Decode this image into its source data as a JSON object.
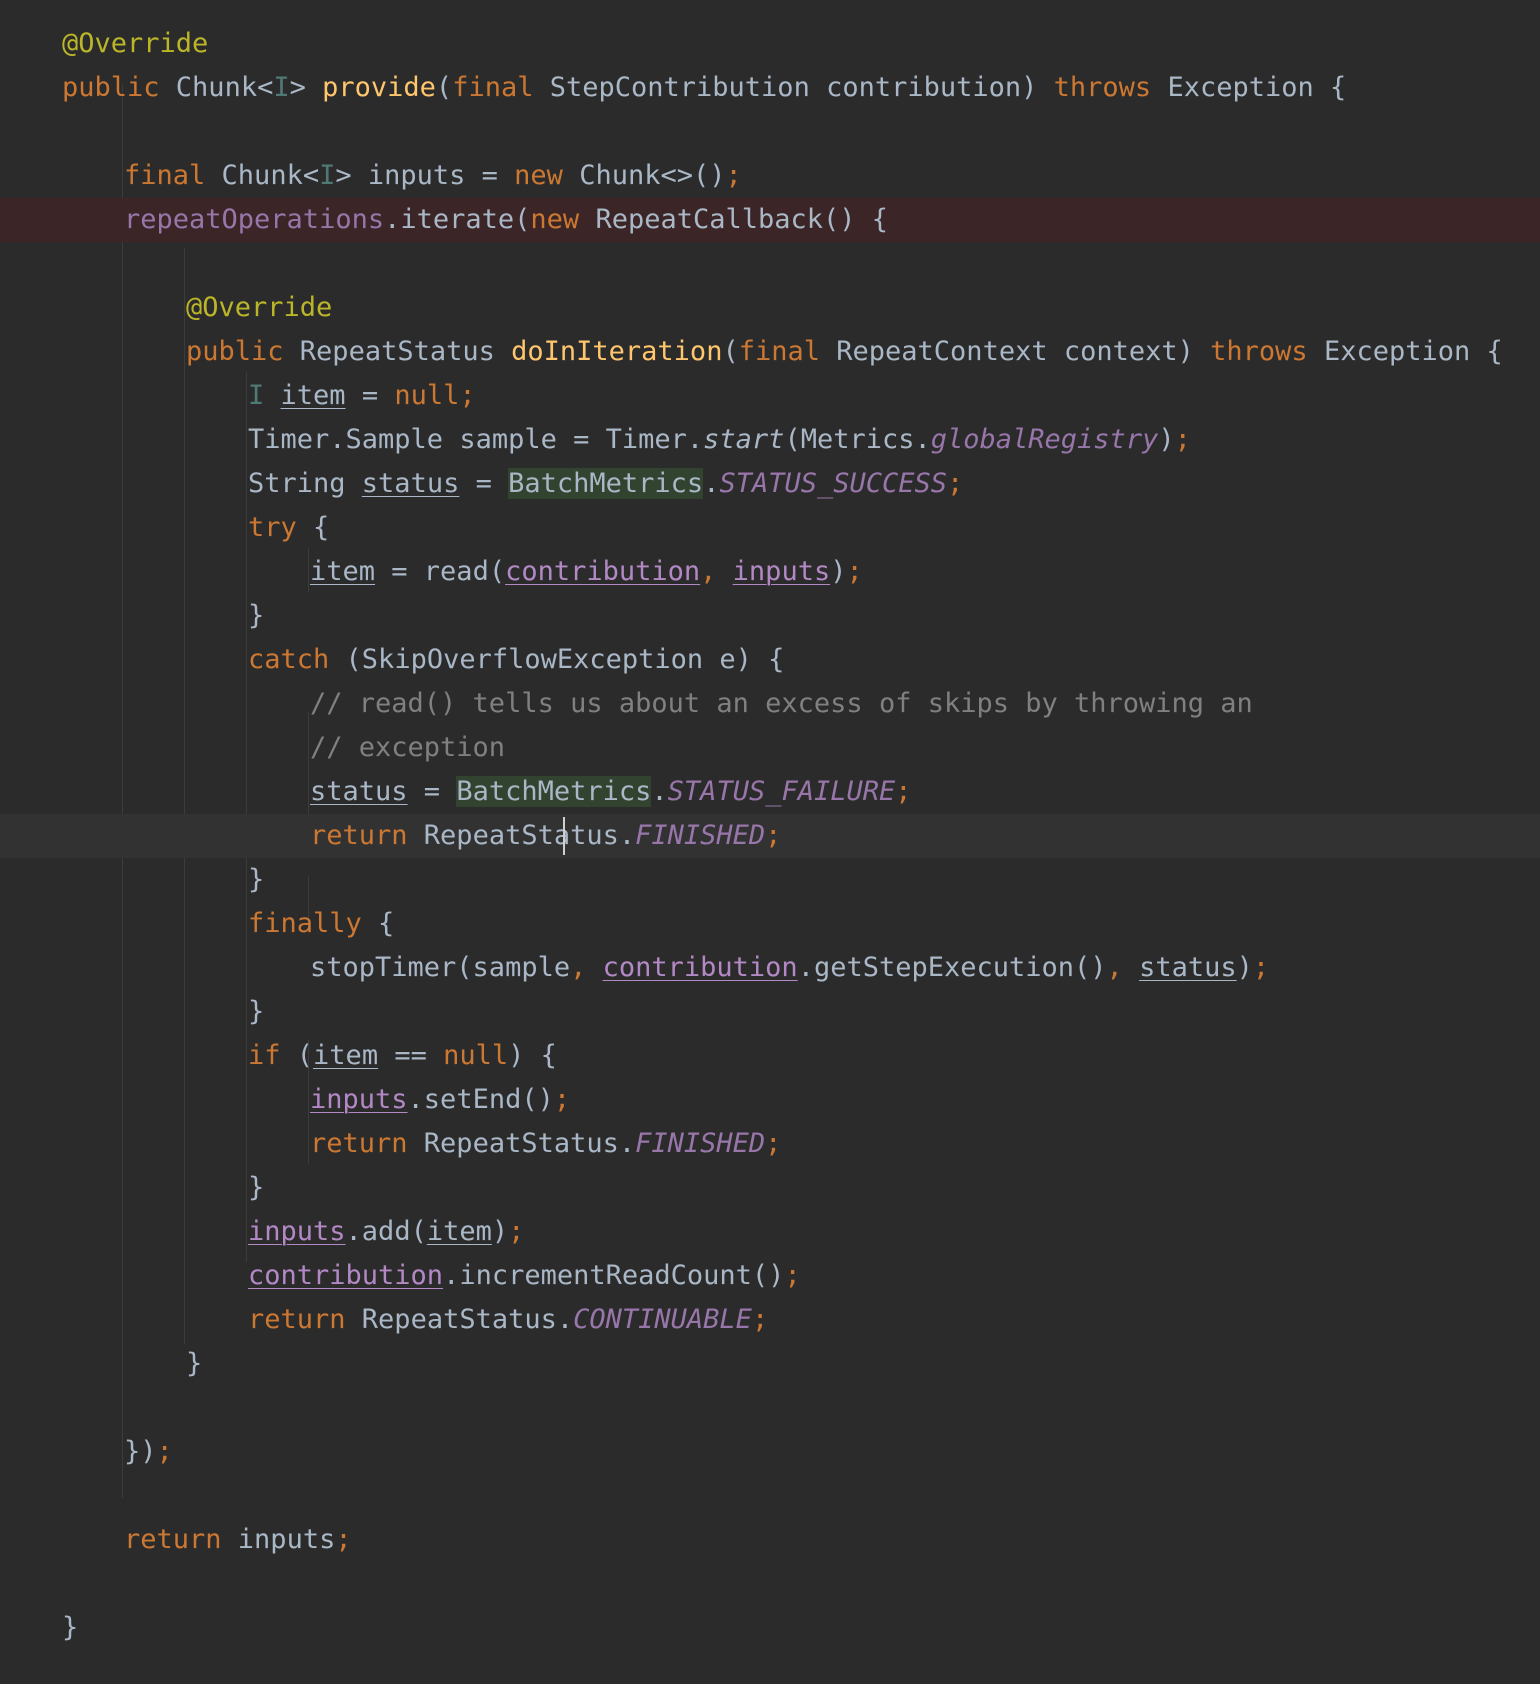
{
  "editor": {
    "language": "java",
    "caret_line": 18,
    "error_line": 4,
    "theme_colors": {
      "background": "#2b2b2b",
      "keyword": "#cc7832",
      "annotation": "#bbb529",
      "method_declaration": "#ffc66d",
      "field": "#9876aa",
      "comment": "#808080",
      "default_text": "#a9b7c6",
      "type_parameter": "#507874",
      "error_line_background": "#3b2526",
      "caret_line_background": "#323232",
      "usage_highlight": "#32432f"
    },
    "lines": [
      {
        "indent": 1,
        "tokens": [
          {
            "t": "@Override",
            "c": "ann"
          }
        ]
      },
      {
        "indent": 1,
        "tokens": [
          {
            "t": "public ",
            "c": "kw"
          },
          {
            "t": "Chunk<"
          },
          {
            "t": "I",
            "c": "tp"
          },
          {
            "t": "> "
          },
          {
            "t": "provide",
            "c": "fn"
          },
          {
            "t": "("
          },
          {
            "t": "final ",
            "c": "kw"
          },
          {
            "t": "StepContribution contribution) "
          },
          {
            "t": "throws ",
            "c": "kw"
          },
          {
            "t": "Exception {"
          }
        ]
      },
      {
        "indent": 0,
        "tokens": []
      },
      {
        "indent": 2,
        "tokens": [
          {
            "t": "final ",
            "c": "kw"
          },
          {
            "t": "Chunk<"
          },
          {
            "t": "I",
            "c": "tp"
          },
          {
            "t": "> inputs = "
          },
          {
            "t": "new ",
            "c": "kw"
          },
          {
            "t": "Chunk<>()"
          },
          {
            "t": ";",
            "c": "kw"
          }
        ]
      },
      {
        "indent": 2,
        "tokens": [
          {
            "t": "repeatOperations",
            "c": "fld"
          },
          {
            "t": ".iterate("
          },
          {
            "t": "new ",
            "c": "kw"
          },
          {
            "t": "RepeatCallback() {"
          }
        ]
      },
      {
        "indent": 0,
        "tokens": []
      },
      {
        "indent": 3,
        "tokens": [
          {
            "t": "@Override",
            "c": "ann"
          }
        ]
      },
      {
        "indent": 3,
        "tokens": [
          {
            "t": "public ",
            "c": "kw"
          },
          {
            "t": "RepeatStatus "
          },
          {
            "t": "doInIteration",
            "c": "fn"
          },
          {
            "t": "("
          },
          {
            "t": "final ",
            "c": "kw"
          },
          {
            "t": "RepeatContext context) "
          },
          {
            "t": "throws ",
            "c": "kw"
          },
          {
            "t": "Exception {"
          }
        ]
      },
      {
        "indent": 4,
        "tokens": [
          {
            "t": "I",
            "c": "tp"
          },
          {
            "t": " "
          },
          {
            "t": "item",
            "c": "ul"
          },
          {
            "t": " = "
          },
          {
            "t": "null",
            "c": "kw"
          },
          {
            "t": ";",
            "c": "kw"
          }
        ]
      },
      {
        "indent": 4,
        "tokens": [
          {
            "t": "Timer.Sample sample = Timer."
          },
          {
            "t": "start",
            "c": "mth"
          },
          {
            "t": "(Metrics."
          },
          {
            "t": "globalRegistry",
            "c": "sf"
          },
          {
            "t": ")"
          },
          {
            "t": ";",
            "c": "kw"
          }
        ]
      },
      {
        "indent": 4,
        "tokens": [
          {
            "t": "String "
          },
          {
            "t": "status",
            "c": "ul"
          },
          {
            "t": " = "
          },
          {
            "t": "BatchMetrics",
            "c": "hlw"
          },
          {
            "t": "."
          },
          {
            "t": "STATUS_SUCCESS",
            "c": "sf"
          },
          {
            "t": ";",
            "c": "kw"
          }
        ]
      },
      {
        "indent": 4,
        "tokens": [
          {
            "t": "try ",
            "c": "kw"
          },
          {
            "t": "{"
          }
        ]
      },
      {
        "indent": 5,
        "tokens": [
          {
            "t": "item",
            "c": "ul"
          },
          {
            "t": " = read("
          },
          {
            "t": "contribution",
            "c": "pul"
          },
          {
            "t": ", ",
            "c": "kw"
          },
          {
            "t": "inputs",
            "c": "pul"
          },
          {
            "t": ")"
          },
          {
            "t": ";",
            "c": "kw"
          }
        ]
      },
      {
        "indent": 4,
        "tokens": [
          {
            "t": "}"
          }
        ]
      },
      {
        "indent": 4,
        "tokens": [
          {
            "t": "catch ",
            "c": "kw"
          },
          {
            "t": "(SkipOverflowException e) {"
          }
        ]
      },
      {
        "indent": 5,
        "tokens": [
          {
            "t": "// read() tells us about an excess of skips by throwing an",
            "c": "cm"
          }
        ]
      },
      {
        "indent": 5,
        "tokens": [
          {
            "t": "// exception",
            "c": "cm"
          }
        ]
      },
      {
        "indent": 5,
        "tokens": [
          {
            "t": "status",
            "c": "ul"
          },
          {
            "t": " = "
          },
          {
            "t": "BatchMetrics",
            "c": "hlw"
          },
          {
            "t": "."
          },
          {
            "t": "STATUS_FAILURE",
            "c": "sf"
          },
          {
            "t": ";",
            "c": "kw"
          }
        ]
      },
      {
        "indent": 5,
        "tokens": [
          {
            "t": "return ",
            "c": "kw"
          },
          {
            "t": "RepeatStatus."
          },
          {
            "t": "FINISHED",
            "c": "sf"
          },
          {
            "t": ";",
            "c": "kw"
          }
        ]
      },
      {
        "indent": 4,
        "tokens": [
          {
            "t": "}"
          }
        ]
      },
      {
        "indent": 4,
        "tokens": [
          {
            "t": "finally ",
            "c": "kw"
          },
          {
            "t": "{"
          }
        ]
      },
      {
        "indent": 5,
        "tokens": [
          {
            "t": "stopTimer(sample"
          },
          {
            "t": ", ",
            "c": "kw"
          },
          {
            "t": "contribution",
            "c": "pul"
          },
          {
            "t": ".getStepExecution()"
          },
          {
            "t": ", ",
            "c": "kw"
          },
          {
            "t": "status",
            "c": "ul"
          },
          {
            "t": ")"
          },
          {
            "t": ";",
            "c": "kw"
          }
        ]
      },
      {
        "indent": 4,
        "tokens": [
          {
            "t": "}"
          }
        ]
      },
      {
        "indent": 4,
        "tokens": [
          {
            "t": "if ",
            "c": "kw"
          },
          {
            "t": "("
          },
          {
            "t": "item",
            "c": "ul"
          },
          {
            "t": " == "
          },
          {
            "t": "null",
            "c": "kw"
          },
          {
            "t": ") {"
          }
        ]
      },
      {
        "indent": 5,
        "tokens": [
          {
            "t": "inputs",
            "c": "pul"
          },
          {
            "t": ".setEnd()"
          },
          {
            "t": ";",
            "c": "kw"
          }
        ]
      },
      {
        "indent": 5,
        "tokens": [
          {
            "t": "return ",
            "c": "kw"
          },
          {
            "t": "RepeatStatus."
          },
          {
            "t": "FINISHED",
            "c": "sf"
          },
          {
            "t": ";",
            "c": "kw"
          }
        ]
      },
      {
        "indent": 4,
        "tokens": [
          {
            "t": "}"
          }
        ]
      },
      {
        "indent": 4,
        "tokens": [
          {
            "t": "inputs",
            "c": "pul"
          },
          {
            "t": ".add("
          },
          {
            "t": "item",
            "c": "ul"
          },
          {
            "t": ")"
          },
          {
            "t": ";",
            "c": "kw"
          }
        ]
      },
      {
        "indent": 4,
        "tokens": [
          {
            "t": "contribution",
            "c": "pul"
          },
          {
            "t": ".incrementReadCount()"
          },
          {
            "t": ";",
            "c": "kw"
          }
        ]
      },
      {
        "indent": 4,
        "tokens": [
          {
            "t": "return ",
            "c": "kw"
          },
          {
            "t": "RepeatStatus."
          },
          {
            "t": "CONTINUABLE",
            "c": "sf"
          },
          {
            "t": ";",
            "c": "kw"
          }
        ]
      },
      {
        "indent": 3,
        "tokens": [
          {
            "t": "}"
          }
        ]
      },
      {
        "indent": 0,
        "tokens": []
      },
      {
        "indent": 2,
        "tokens": [
          {
            "t": "})"
          },
          {
            "t": ";",
            "c": "kw"
          }
        ]
      },
      {
        "indent": 0,
        "tokens": []
      },
      {
        "indent": 2,
        "tokens": [
          {
            "t": "return ",
            "c": "kw"
          },
          {
            "t": "inputs"
          },
          {
            "t": ";",
            "c": "kw"
          }
        ]
      },
      {
        "indent": 0,
        "tokens": []
      },
      {
        "indent": 1,
        "tokens": [
          {
            "t": "}"
          }
        ]
      }
    ]
  }
}
